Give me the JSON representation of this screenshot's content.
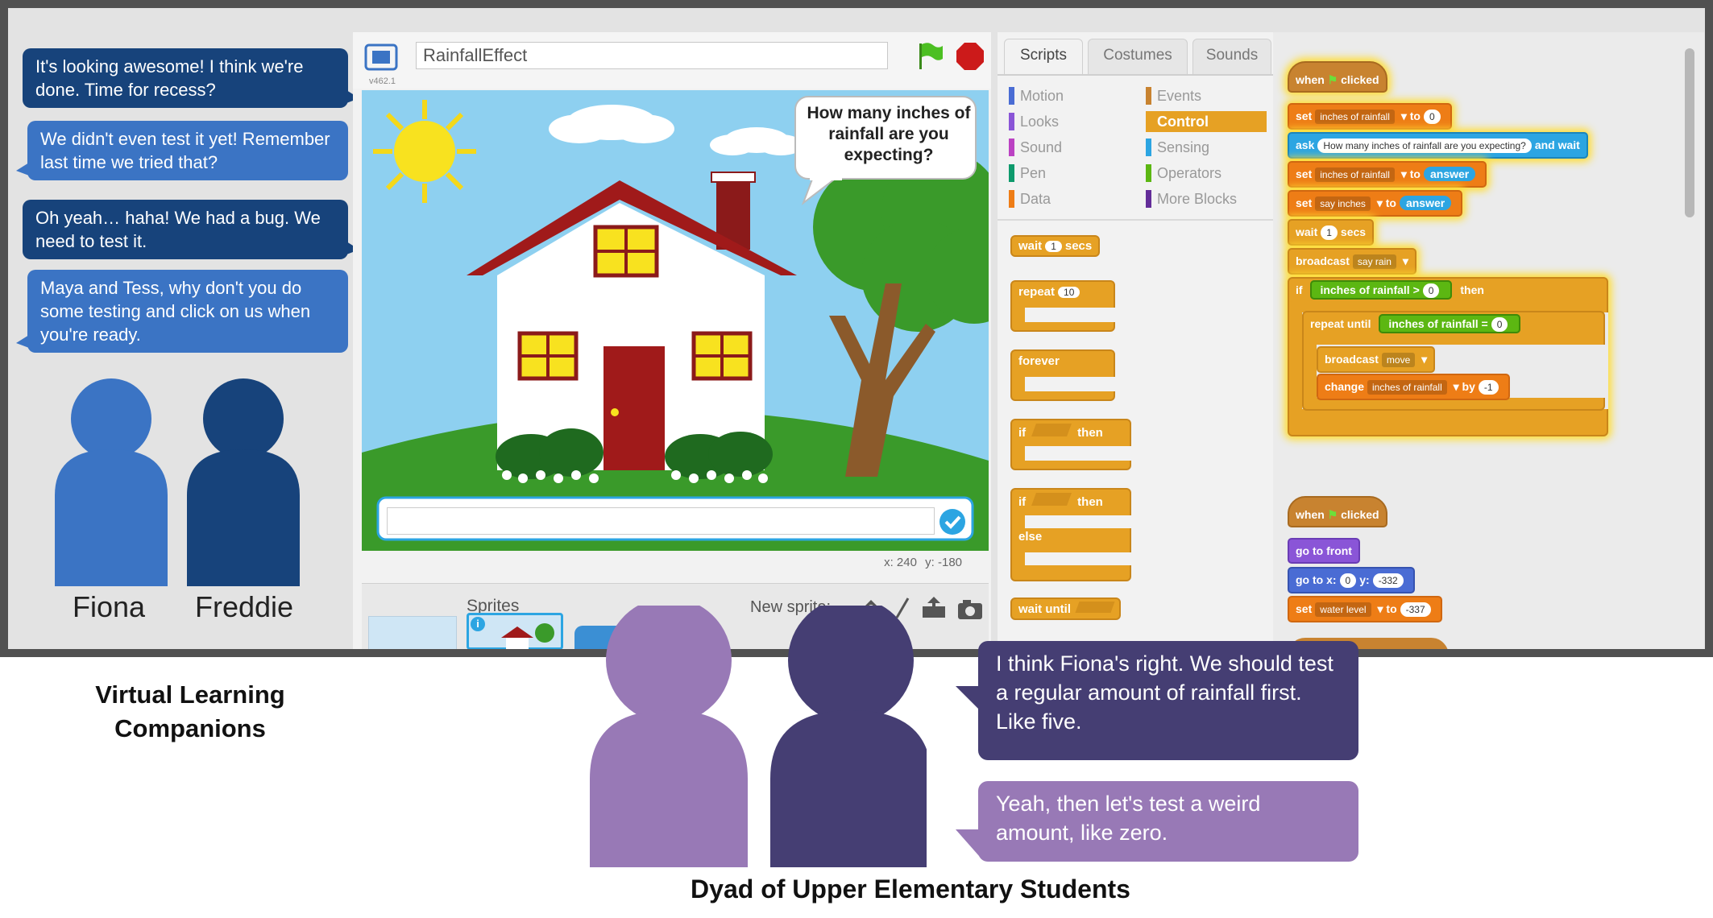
{
  "companions": {
    "bubbles": [
      "It's looking awesome! I think we're done. Time for recess?",
      "We didn't even test it yet! Remember last time we tried that?",
      "Oh yeah… haha! We had a bug. We need to test it.",
      "Maya and Tess, why don't you do some testing and click on us when you're ready."
    ],
    "fiona": "Fiona",
    "freddie": "Freddie"
  },
  "stage": {
    "project_title": "RainfallEffect",
    "version": "v462.1",
    "speech": "How many inches of rainfall are you expecting?",
    "coords_x": "x: 240",
    "coords_y": "y: -180",
    "sprites_label": "Sprites",
    "new_sprite_label": "New sprite:"
  },
  "palette": {
    "tabs": [
      "Scripts",
      "Costumes",
      "Sounds"
    ],
    "categories_left": [
      "Motion",
      "Looks",
      "Sound",
      "Pen",
      "Data"
    ],
    "categories_right": [
      "Events",
      "Control",
      "Sensing",
      "Operators",
      "More Blocks"
    ],
    "blocks": {
      "wait": "wait",
      "wait_secs": "secs",
      "wait_num": "1",
      "repeat": "repeat",
      "repeat_num": "10",
      "forever": "forever",
      "if": "if",
      "then": "then",
      "else": "else",
      "wait_until": "wait until"
    }
  },
  "script": {
    "when": "when",
    "clicked": "clicked",
    "set": "set",
    "to": "to",
    "var_rain": "inches of rainfall",
    "var_say": "say inches",
    "var_water": "water level",
    "zero": "0",
    "ask": "ask",
    "ask_text": "How many inches of rainfall are you expecting?",
    "and_wait": "and wait",
    "answer": "answer",
    "wait": "wait",
    "one": "1",
    "secs": "secs",
    "broadcast": "broadcast",
    "say_rain": "say rain",
    "if": "if",
    "gt": ">",
    "then": "then",
    "repeat_until": "repeat until",
    "eq": "=",
    "move": "move",
    "change": "change",
    "by": "by",
    "neg_one": "-1",
    "go_to_front": "go to front",
    "go_to_x": "go to x:",
    "y": "y:",
    "neg_332": "-332",
    "neg_337": "-337"
  },
  "captions": {
    "vlc": "Virtual Learning Companions",
    "dyad": "Dyad of Upper Elementary Students"
  },
  "students": {
    "bubble1": "I think Fiona's right. We should test a regular amount of rainfall first. Like five.",
    "bubble2": "Yeah, then let's test a weird amount, like zero."
  },
  "colors": {
    "companion_dark": "#17437b",
    "companion_light": "#3b74c4",
    "student_dark": "#453e73",
    "student_light": "#9879b6",
    "control_block": "#e6a124"
  }
}
